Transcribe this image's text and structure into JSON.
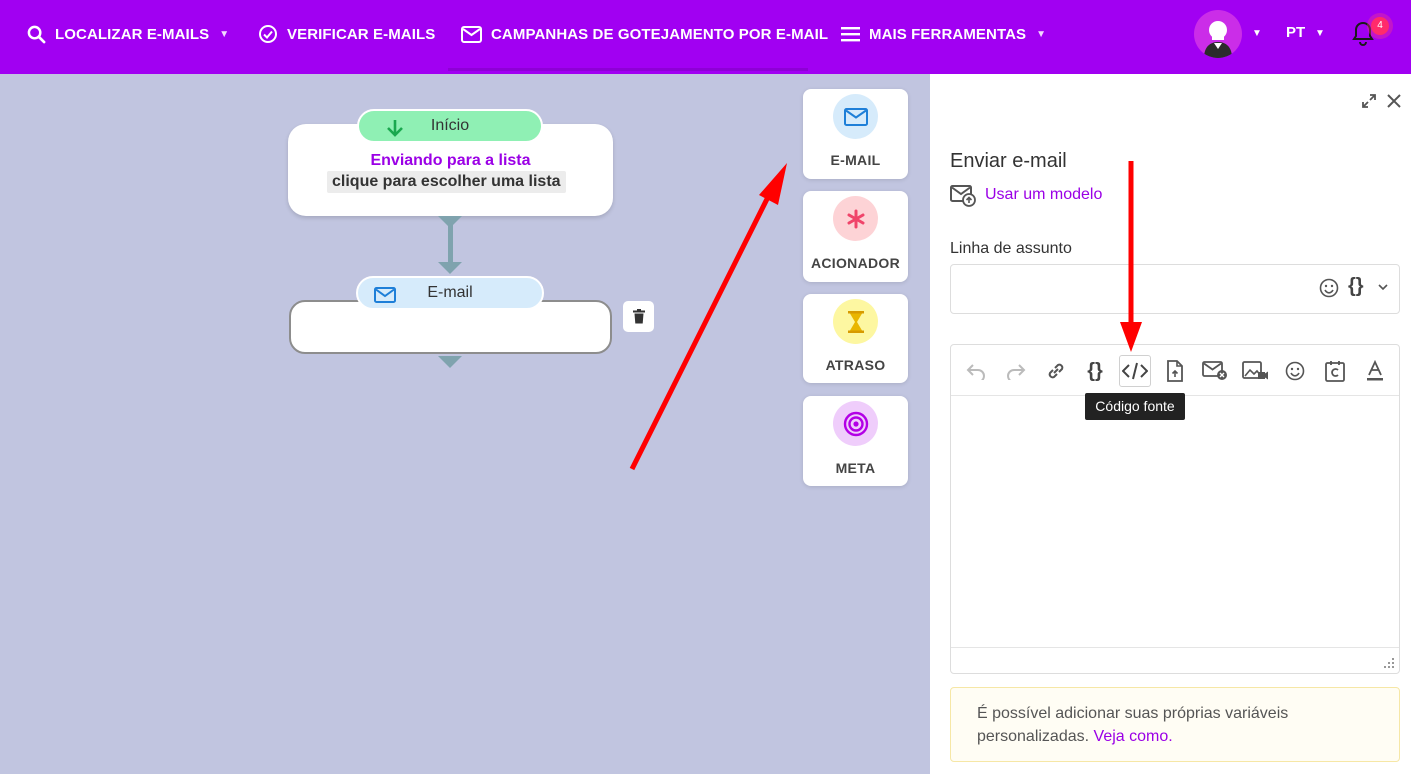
{
  "nav": {
    "find_emails": "LOCALIZAR E-MAILS",
    "verify_emails": "VERIFICAR E-MAILS",
    "drip_campaigns": "CAMPANHAS DE GOTEJAMENTO POR E-MAIL",
    "more_tools": "MAIS FERRAMENTAS",
    "language": "PT",
    "notification_count": "4"
  },
  "flow": {
    "start_label": "Início",
    "sending_to_list": "Enviando para a lista",
    "choose_list": "clique para escolher uma lista",
    "email_node_label": "E-mail"
  },
  "palette": [
    {
      "label": "E-MAIL",
      "icon": "envelope-icon"
    },
    {
      "label": "ACIONADOR",
      "icon": "asterisk-icon"
    },
    {
      "label": "ATRASO",
      "icon": "hourglass-icon"
    },
    {
      "label": "META",
      "icon": "target-icon"
    }
  ],
  "panel": {
    "title": "Enviar e-mail",
    "use_template": "Usar um modelo",
    "subject_label": "Linha de assunto",
    "subject_value": "",
    "tooltip": "Código fonte",
    "info_text": "É possível adicionar suas próprias variáveis personalizadas.",
    "info_link": "Veja como."
  },
  "colors": {
    "brand": "#a100f2",
    "canvas": "#c1c5e0",
    "link": "#9b00e6",
    "annotation_arrow": "#ff0000"
  }
}
